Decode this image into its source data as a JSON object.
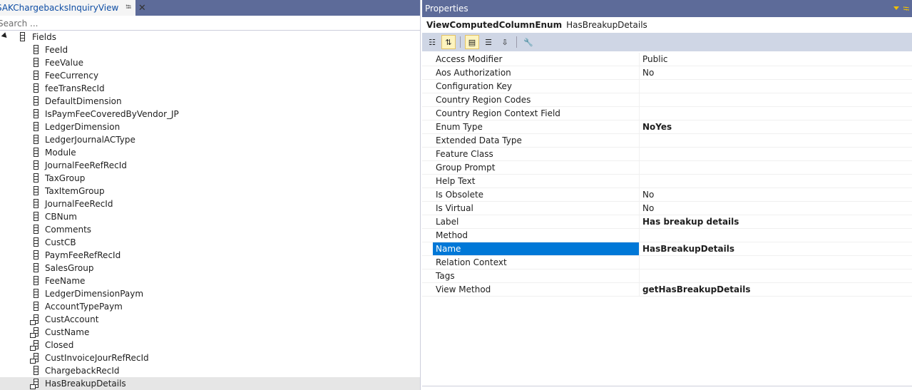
{
  "left_panel": {
    "tab_title": "SAKChargebacksInquiryView",
    "search_placeholder": "Search ...",
    "root": {
      "label": "Fields"
    },
    "fields": [
      {
        "label": "FeeId",
        "computed": false
      },
      {
        "label": "FeeValue",
        "computed": false
      },
      {
        "label": "FeeCurrency",
        "computed": false
      },
      {
        "label": "feeTransRecId",
        "computed": false
      },
      {
        "label": "DefaultDimension",
        "computed": false
      },
      {
        "label": "IsPaymFeeCoveredByVendor_JP",
        "computed": false
      },
      {
        "label": "LedgerDimension",
        "computed": false
      },
      {
        "label": "LedgerJournalACType",
        "computed": false
      },
      {
        "label": "Module",
        "computed": false
      },
      {
        "label": "JournalFeeRefRecId",
        "computed": false
      },
      {
        "label": "TaxGroup",
        "computed": false
      },
      {
        "label": "TaxItemGroup",
        "computed": false
      },
      {
        "label": "JournalFeeRecId",
        "computed": false
      },
      {
        "label": "CBNum",
        "computed": false
      },
      {
        "label": "Comments",
        "computed": false
      },
      {
        "label": "CustCB",
        "computed": false
      },
      {
        "label": "PaymFeeRefRecId",
        "computed": false
      },
      {
        "label": "SalesGroup",
        "computed": false
      },
      {
        "label": "FeeName",
        "computed": false
      },
      {
        "label": "LedgerDimensionPaym",
        "computed": false
      },
      {
        "label": "AccountTypePaym",
        "computed": false
      },
      {
        "label": "CustAccount",
        "computed": true
      },
      {
        "label": "CustName",
        "computed": true
      },
      {
        "label": "Closed",
        "computed": true
      },
      {
        "label": "CustInvoiceJourRefRecId",
        "computed": true
      },
      {
        "label": "ChargebackRecId",
        "computed": false
      },
      {
        "label": "HasBreakupDetails",
        "computed": true,
        "selected": true
      }
    ]
  },
  "properties": {
    "title": "Properties",
    "object_type": "ViewComputedColumnEnum",
    "object_name": "HasBreakupDetails",
    "rows": [
      {
        "name": "Access Modifier",
        "value": "Public",
        "bold": false
      },
      {
        "name": "Aos Authorization",
        "value": "No",
        "bold": false
      },
      {
        "name": "Configuration Key",
        "value": "",
        "bold": false
      },
      {
        "name": "Country Region Codes",
        "value": "",
        "bold": false
      },
      {
        "name": "Country Region Context Field",
        "value": "",
        "bold": false
      },
      {
        "name": "Enum Type",
        "value": "NoYes",
        "bold": true
      },
      {
        "name": "Extended Data Type",
        "value": "",
        "bold": false
      },
      {
        "name": "Feature Class",
        "value": "",
        "bold": false
      },
      {
        "name": "Group Prompt",
        "value": "",
        "bold": false
      },
      {
        "name": "Help Text",
        "value": "",
        "bold": false
      },
      {
        "name": "Is Obsolete",
        "value": "No",
        "bold": false
      },
      {
        "name": "Is Virtual",
        "value": "No",
        "bold": false
      },
      {
        "name": "Label",
        "value": "Has breakup details",
        "bold": true
      },
      {
        "name": "Method",
        "value": "",
        "bold": false
      },
      {
        "name": "Name",
        "value": "HasBreakupDetails",
        "bold": true,
        "selected": true
      },
      {
        "name": "Relation Context",
        "value": "",
        "bold": false
      },
      {
        "name": "Tags",
        "value": "",
        "bold": false
      },
      {
        "name": "View Method",
        "value": "getHasBreakupDetails",
        "bold": true
      }
    ]
  },
  "colors": {
    "title_bar": "#5d6b99",
    "selection": "#0078d7",
    "toolbar": "#cfd6e5"
  }
}
